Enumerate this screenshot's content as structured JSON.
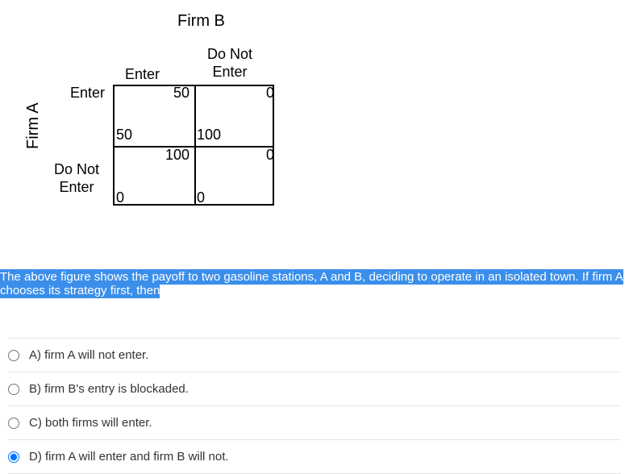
{
  "figure": {
    "firmB": "Firm B",
    "firmA": "Firm A",
    "col1": "Enter",
    "col2_line1": "Do Not",
    "col2_line2": "Enter",
    "row1": "Enter",
    "row2_line1": "Do Not",
    "row2_line2": "Enter",
    "payoffs": {
      "tl_b": "50",
      "tl_a": "50",
      "tr_b": "0",
      "tr_a": "100",
      "bl_b": "100",
      "bl_a": "0",
      "br_b": "0",
      "br_a": "0"
    }
  },
  "question": {
    "text": "The above figure shows the payoff to two gasoline stations, A and B, deciding to operate in an isolated town. If firm A chooses its strategy first, then"
  },
  "options": {
    "a": "A) firm A will not enter.",
    "b": "B) firm B's entry is blockaded.",
    "c": "C) both firms will enter.",
    "d": "D) firm A will enter and firm B will not."
  }
}
